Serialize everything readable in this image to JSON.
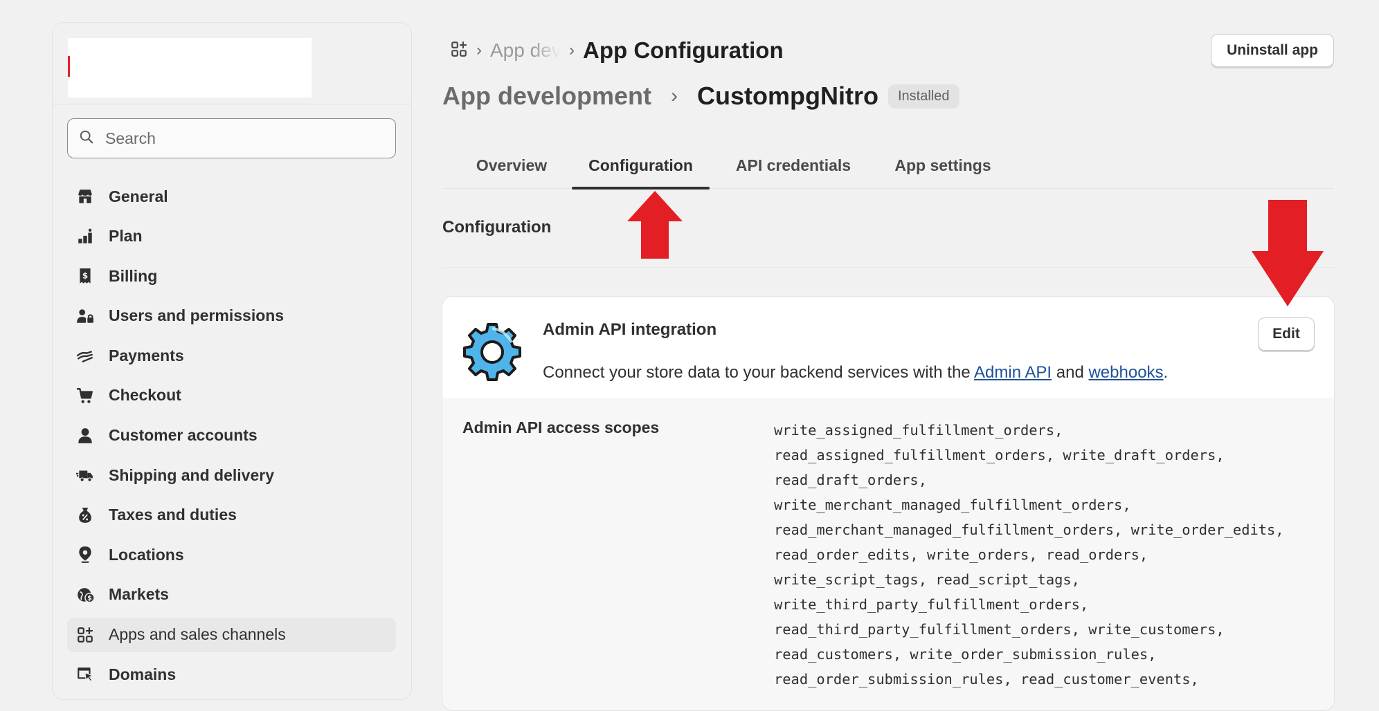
{
  "sidebar": {
    "search_placeholder": "Search",
    "items": [
      {
        "label": "General",
        "icon": "store-icon"
      },
      {
        "label": "Plan",
        "icon": "plan-icon"
      },
      {
        "label": "Billing",
        "icon": "billing-icon"
      },
      {
        "label": "Users and permissions",
        "icon": "users-icon"
      },
      {
        "label": "Payments",
        "icon": "payments-icon"
      },
      {
        "label": "Checkout",
        "icon": "cart-icon"
      },
      {
        "label": "Customer accounts",
        "icon": "person-icon"
      },
      {
        "label": "Shipping and delivery",
        "icon": "truck-icon"
      },
      {
        "label": "Taxes and duties",
        "icon": "tax-icon"
      },
      {
        "label": "Locations",
        "icon": "location-pin-icon"
      },
      {
        "label": "Markets",
        "icon": "globe-icon"
      },
      {
        "label": "Apps and sales channels",
        "icon": "apps-icon",
        "active": true
      },
      {
        "label": "Domains",
        "icon": "domains-icon"
      }
    ]
  },
  "header": {
    "breadcrumb_parent": "App dev",
    "breadcrumb_current": "App Configuration",
    "uninstall_label": "Uninstall app",
    "title_parent": "App development",
    "title_app": "CustompgNitro",
    "status_badge": "Installed"
  },
  "tabs": [
    {
      "label": "Overview"
    },
    {
      "label": "Configuration",
      "active": true
    },
    {
      "label": "API credentials"
    },
    {
      "label": "App settings"
    }
  ],
  "section": {
    "title": "Configuration"
  },
  "card": {
    "title": "Admin API integration",
    "description_prefix": "Connect your store data to your backend services with the ",
    "link1": "Admin API",
    "description_middle": " and ",
    "link2": "webhooks",
    "description_suffix": ".",
    "edit_label": "Edit",
    "scopes_label": "Admin API access scopes",
    "scopes_text": "write_assigned_fulfillment_orders,\nread_assigned_fulfillment_orders, write_draft_orders,\nread_draft_orders,\nwrite_merchant_managed_fulfillment_orders,\nread_merchant_managed_fulfillment_orders, write_order_edits,\nread_order_edits, write_orders, read_orders,\nwrite_script_tags, read_script_tags,\nwrite_third_party_fulfillment_orders,\nread_third_party_fulfillment_orders, write_customers,\nread_customers, write_order_submission_rules,\nread_order_submission_rules, read_customer_events,"
  },
  "colors": {
    "annotation_arrow": "#e31e24",
    "link": "#1f5199",
    "background": "#f1f1f1"
  }
}
